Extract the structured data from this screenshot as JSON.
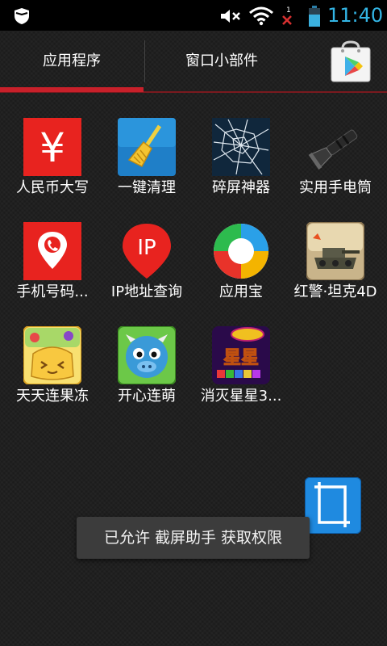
{
  "status_bar": {
    "time": "11:40",
    "signal_badge": "1",
    "icons": [
      "shield-icon",
      "mute-icon",
      "wifi-icon",
      "no-signal-icon",
      "battery-icon"
    ],
    "accent_color": "#33b5e5"
  },
  "tabs": [
    {
      "label": "应用程序",
      "active": true
    },
    {
      "label": "窗口小部件",
      "active": false
    }
  ],
  "store_icon": "play-store-icon",
  "tab_accent_color": "#c8202a",
  "apps": [
    {
      "label": "人民币大写",
      "icon": "yuan-icon"
    },
    {
      "label": "一键清理",
      "icon": "broom-icon"
    },
    {
      "label": "碎屏神器",
      "icon": "cracked-screen-icon"
    },
    {
      "label": "实用手电筒",
      "icon": "flashlight-icon"
    },
    {
      "label": "手机号码...",
      "icon": "phone-location-icon"
    },
    {
      "label": "IP地址查询",
      "icon": "ip-location-icon"
    },
    {
      "label": "应用宝",
      "icon": "app-store-icon"
    },
    {
      "label": "红警·坦克4D",
      "icon": "tank-game-icon"
    },
    {
      "label": "天天连果冻",
      "icon": "jelly-game-icon"
    },
    {
      "label": "开心连萌",
      "icon": "cute-game-icon"
    },
    {
      "label": "消灭星星3...",
      "icon": "star-game-icon"
    }
  ],
  "ip_icon_text": "IP",
  "yuan_icon_text": "¥",
  "star_icon_text": "星星",
  "capture_button_icon": "crop-icon",
  "toast": "已允许 截屏助手 获取权限"
}
